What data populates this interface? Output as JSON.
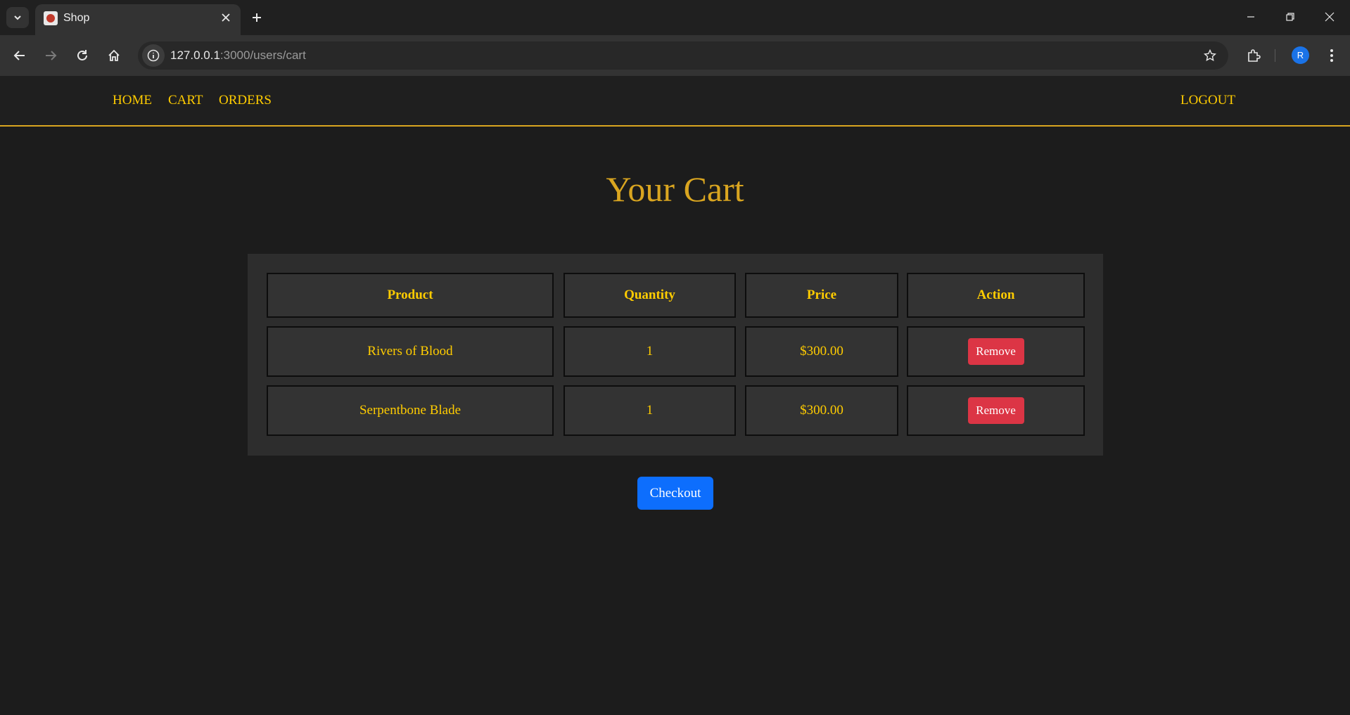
{
  "browser": {
    "tab_title": "Shop",
    "url_host": "127.0.0.1",
    "url_path": ":3000/users/cart",
    "profile_initial": "R",
    "accent": "#1a73e8"
  },
  "nav": {
    "home": "HOME",
    "cart": "CART",
    "orders": "ORDERS",
    "logout": "LOGOUT"
  },
  "page": {
    "title": "Your Cart",
    "checkout_label": "Checkout"
  },
  "table": {
    "headers": [
      "Product",
      "Quantity",
      "Price",
      "Action"
    ],
    "rows": [
      {
        "product": "Rivers of Blood",
        "quantity": "1",
        "price": "$300.00",
        "action": "Remove"
      },
      {
        "product": "Serpentbone Blade",
        "quantity": "1",
        "price": "$300.00",
        "action": "Remove"
      }
    ]
  },
  "colors": {
    "gold": "#ffcc00",
    "title_gold": "#d9a520",
    "remove_red": "#dc3545",
    "checkout_blue": "#0d6efd"
  }
}
